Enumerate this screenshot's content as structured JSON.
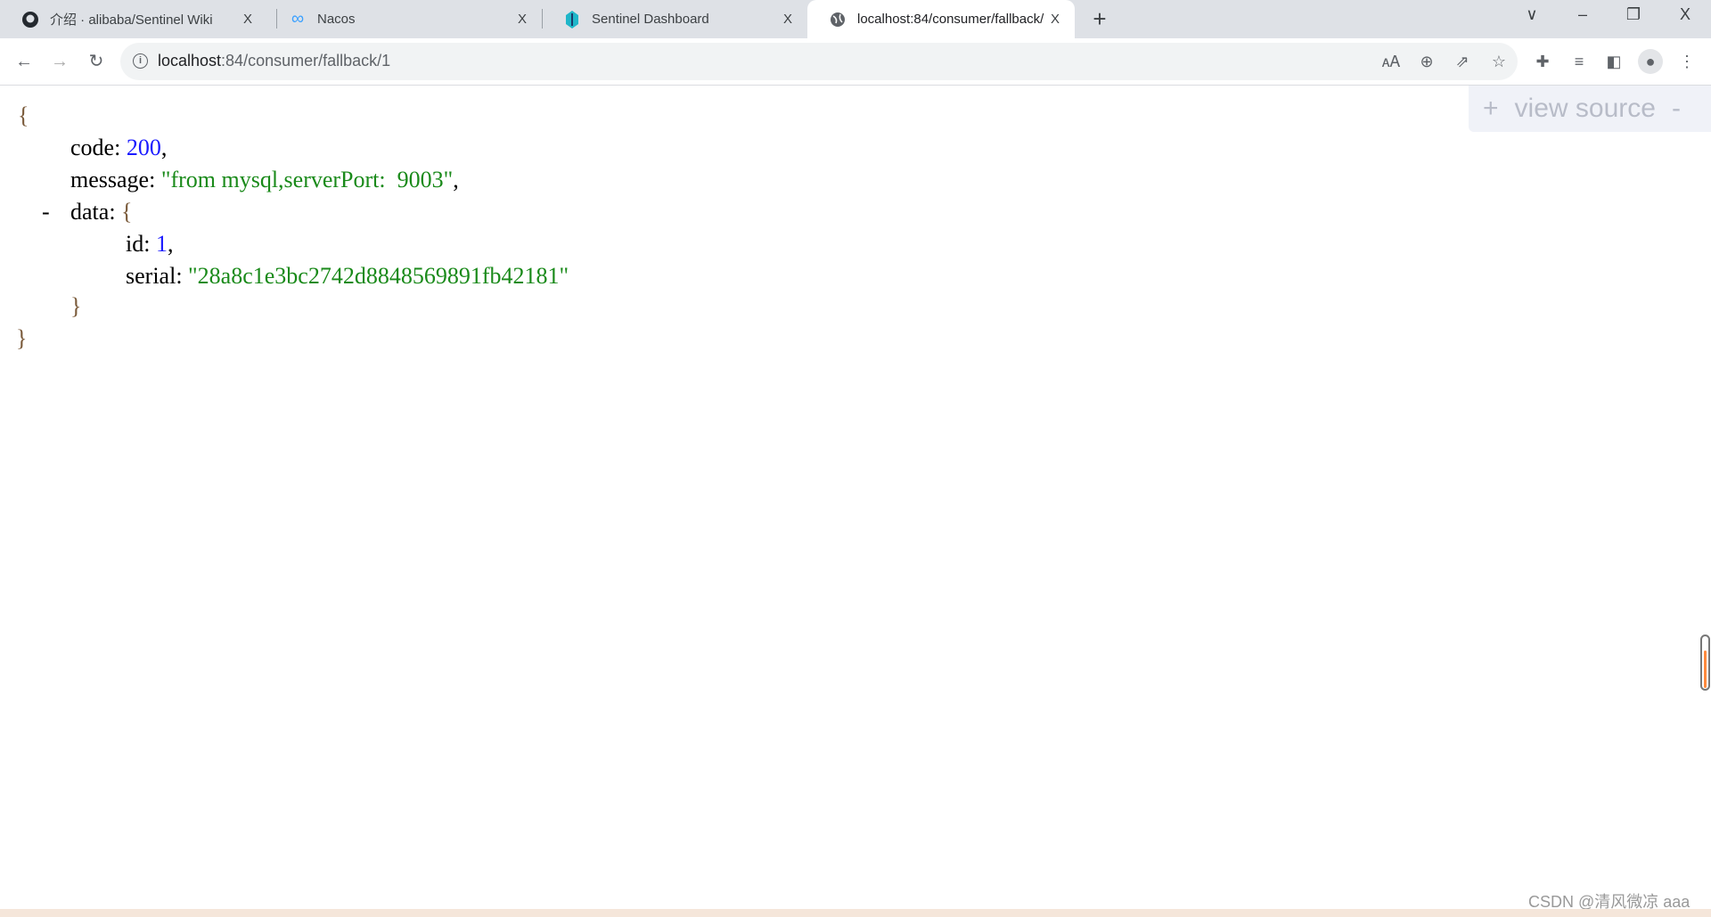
{
  "browser": {
    "tabs": [
      {
        "title": "介绍 · alibaba/Sentinel Wiki",
        "icon": "github-icon",
        "close": "X"
      },
      {
        "title": "Nacos",
        "icon": "nacos-infinity-icon",
        "close": "X"
      },
      {
        "title": "Sentinel Dashboard",
        "icon": "sentinel-icon",
        "close": "X"
      },
      {
        "title": "localhost:84/consumer/fallback/1",
        "icon": "globe-icon",
        "close": "X",
        "active": true
      }
    ],
    "new_tab": "+",
    "window_controls": {
      "tab_search": "∨",
      "minimize": "–",
      "restore": "❐",
      "close": "X"
    },
    "address": {
      "host": "localhost",
      "rest": ":84/consumer/fallback/1"
    },
    "toolbar_icons": [
      "translate-icon",
      "zoom-icon",
      "share-icon",
      "bookmark-star-icon",
      "extensions-icon",
      "media-icon",
      "side-panel-icon",
      "profile-icon",
      "menu-icon"
    ]
  },
  "json": {
    "open": "{",
    "code_key": "code",
    "code_value": "200",
    "message_key": "message",
    "message_value": "\"from mysql,serverPort:  9003\"",
    "collapse_toggle": "-",
    "data_key": "data",
    "data_open": "{",
    "id_key": "id",
    "id_value": "1",
    "serial_key": "serial",
    "serial_value": "\"28a8c1e3bc2742d8848569891fb42181\"",
    "data_close": "}",
    "close": "}"
  },
  "view_source": {
    "plus": "+",
    "label": "view source",
    "minus": "-"
  },
  "watermark": "CSDN @清风微凉 aaa",
  "colors": {
    "number": "#1a1aff",
    "string": "#1a8a1a",
    "accent_scroll": "#ff8a3d"
  }
}
